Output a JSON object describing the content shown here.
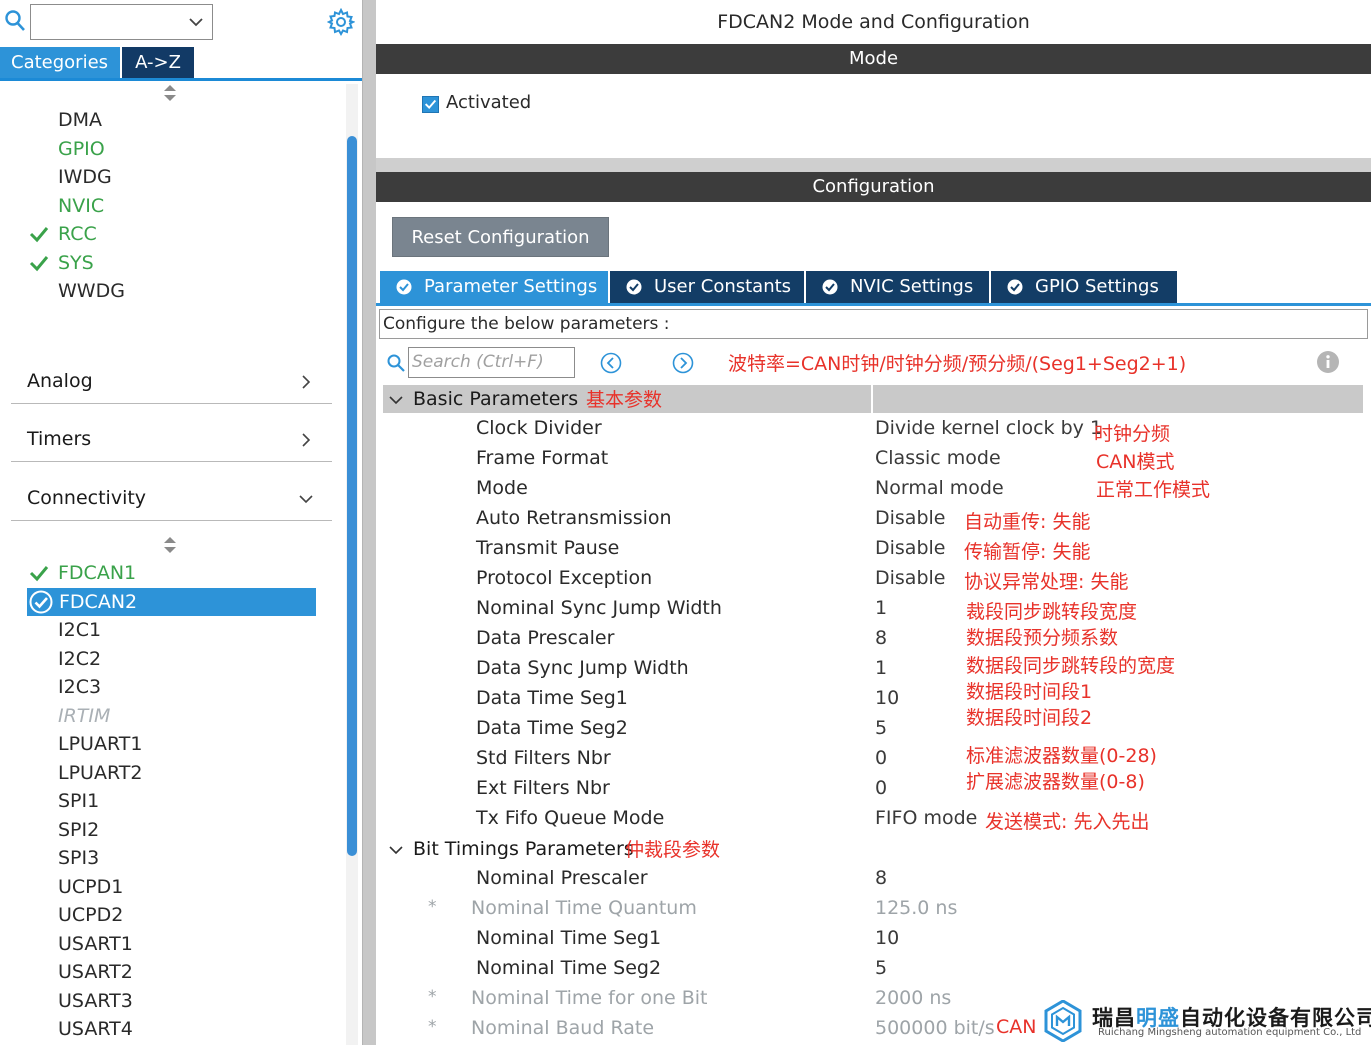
{
  "left": {
    "tabs": {
      "categories": "Categories",
      "az": "A->Z"
    },
    "system_items": [
      {
        "label": "DMA",
        "state": "none"
      },
      {
        "label": "GPIO",
        "state": "green"
      },
      {
        "label": "IWDG",
        "state": "none"
      },
      {
        "label": "NVIC",
        "state": "green"
      },
      {
        "label": "RCC",
        "state": "checked"
      },
      {
        "label": "SYS",
        "state": "checked"
      },
      {
        "label": "WWDG",
        "state": "none"
      }
    ],
    "sections": {
      "analog": "Analog",
      "timers": "Timers",
      "connectivity": "Connectivity"
    },
    "connectivity_items": [
      {
        "label": "FDCAN1",
        "state": "checked"
      },
      {
        "label": "FDCAN2",
        "state": "selected"
      },
      {
        "label": "I2C1",
        "state": "none"
      },
      {
        "label": "I2C2",
        "state": "none"
      },
      {
        "label": "I2C3",
        "state": "none"
      },
      {
        "label": "IRTIM",
        "state": "disabled"
      },
      {
        "label": "LPUART1",
        "state": "none"
      },
      {
        "label": "LPUART2",
        "state": "none"
      },
      {
        "label": "SPI1",
        "state": "none"
      },
      {
        "label": "SPI2",
        "state": "none"
      },
      {
        "label": "SPI3",
        "state": "none"
      },
      {
        "label": "UCPD1",
        "state": "none"
      },
      {
        "label": "UCPD2",
        "state": "none"
      },
      {
        "label": "USART1",
        "state": "none"
      },
      {
        "label": "USART2",
        "state": "none"
      },
      {
        "label": "USART3",
        "state": "none"
      },
      {
        "label": "USART4",
        "state": "none"
      }
    ]
  },
  "right": {
    "title": "FDCAN2 Mode and Configuration",
    "mode_header": "Mode",
    "activated_label": "Activated",
    "config_header": "Configuration",
    "reset_label": "Reset Configuration",
    "tabs": {
      "param": "Parameter Settings",
      "user": "User Constants",
      "nvic": "NVIC Settings",
      "gpio": "GPIO Settings"
    },
    "configure_text": "Configure the below parameters :",
    "search_placeholder": "Search (Ctrl+F)",
    "baud_formula": "波特率=CAN时钟/时钟分频/预分频/(Seg1+Seg2+1)",
    "basic_group": "Basic Parameters",
    "basic_group_note": "基本参数",
    "bit_group": "Bit Timings Parameters",
    "bit_group_note": "仲裁段参数",
    "basic_params": [
      {
        "key": "Clock Divider",
        "value": "Divide kernel clock by 1",
        "note": "时钟分频"
      },
      {
        "key": "Frame Format",
        "value": "Classic mode",
        "note": "CAN模式"
      },
      {
        "key": "Mode",
        "value": "Normal mode",
        "note": "正常工作模式"
      },
      {
        "key": "Auto Retransmission",
        "value": "Disable",
        "note": "自动重传: 失能"
      },
      {
        "key": "Transmit Pause",
        "value": "Disable",
        "note": "传输暂停: 失能"
      },
      {
        "key": "Protocol Exception",
        "value": "Disable",
        "note": "协议异常处理: 失能"
      },
      {
        "key": "Nominal Sync Jump Width",
        "value": "1",
        "note": "裁段同步跳转段宽度"
      },
      {
        "key": "Data Prescaler",
        "value": "8",
        "note": "数据段预分频系数"
      },
      {
        "key": "Data Sync Jump Width",
        "value": "1",
        "note": "数据段同步跳转段的宽度"
      },
      {
        "key": "Data Time Seg1",
        "value": "10",
        "note": "数据段时间段1"
      },
      {
        "key": "Data Time Seg2",
        "value": "5",
        "note": "数据段时间段2"
      },
      {
        "key": "Std Filters Nbr",
        "value": "0",
        "note": "标准滤波器数量(0-28)"
      },
      {
        "key": "Ext Filters Nbr",
        "value": "0",
        "note": "扩展滤波器数量(0-8)"
      },
      {
        "key": "Tx Fifo Queue Mode",
        "value": "FIFO mode",
        "note": "发送模式: 先入先出"
      }
    ],
    "bit_params": [
      {
        "key": "Nominal Prescaler",
        "value": "8",
        "star": ""
      },
      {
        "key": "Nominal Time Quantum",
        "value": "125.0 ns",
        "star": "*"
      },
      {
        "key": "Nominal Time Seg1",
        "value": "10",
        "star": ""
      },
      {
        "key": "Nominal Time Seg2",
        "value": "5",
        "star": ""
      },
      {
        "key": "Nominal Time for one Bit",
        "value": "2000 ns",
        "star": "*"
      },
      {
        "key": "Nominal Baud Rate",
        "value": "500000 bit/s",
        "star": "*"
      }
    ],
    "baud_note": "CAN",
    "logo": {
      "cn_a": "瑞昌",
      "cn_b": "明盛",
      "cn_c": "自动化设备有限公司",
      "en": "Ruichang Mingsheng automation equipment Co., Ltd"
    },
    "colors": {
      "accent": "#2d93d8",
      "dark_tab": "#133d66",
      "annotation": "#e8322a",
      "ok_green": "#3aa24a"
    }
  }
}
